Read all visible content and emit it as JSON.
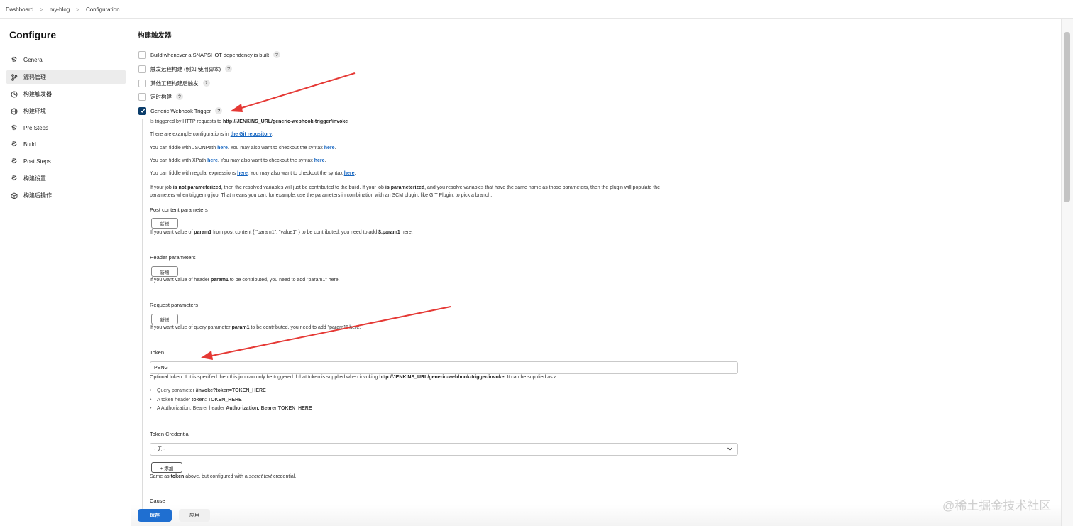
{
  "breadcrumb": {
    "items": [
      "Dashboard",
      "my-blog",
      "Configuration"
    ],
    "separator": ">"
  },
  "sidebar": {
    "title": "Configure",
    "items": [
      {
        "label": "General",
        "icon": "gear-icon"
      },
      {
        "label": "源码管理",
        "icon": "branch-icon"
      },
      {
        "label": "构建触发器",
        "icon": "clock-icon"
      },
      {
        "label": "构建环境",
        "icon": "globe-icon"
      },
      {
        "label": "Pre Steps",
        "icon": "gear-icon"
      },
      {
        "label": "Build",
        "icon": "gear-icon"
      },
      {
        "label": "Post Steps",
        "icon": "gear-icon"
      },
      {
        "label": "构建设置",
        "icon": "gear-icon"
      },
      {
        "label": "构建后操作",
        "icon": "cube-icon"
      }
    ]
  },
  "main": {
    "section_title": "构建触发器",
    "triggers": [
      {
        "label": "Build whenever a SNAPSHOT dependency is built",
        "checked": false
      },
      {
        "label": "触发远程构建 (例如,使用脚本)",
        "checked": false
      },
      {
        "label": "其他工程构建后触发",
        "checked": false
      },
      {
        "label": "定时构建",
        "checked": false
      },
      {
        "label": "Generic Webhook Trigger",
        "checked": true
      }
    ],
    "help_glyph": "?",
    "desc": {
      "line1_prefix": "Is triggered by HTTP requests to ",
      "line1_url": "http://JENKINS_URL/generic-webhook-trigger/invoke",
      "line2_prefix": "There are example configurations in ",
      "line2_link": "the Git repository",
      "line2_suffix": ".",
      "line3_a": "You can fiddle with JSONPath ",
      "line3_link1": "here",
      "line3_b": ". You may also want to checkout the syntax ",
      "line3_link2": "here",
      "line3_c": ".",
      "line4_a": "You can fiddle with XPath ",
      "line4_link1": "here",
      "line4_b": ". You may also want to checkout the syntax ",
      "line4_link2": "here",
      "line4_c": ".",
      "line5_a": "You can fiddle with regular expressions ",
      "line5_link1": "here",
      "line5_b": ". You may also want to checkout the syntax ",
      "line5_link2": "here",
      "line5_c": ".",
      "para_a": "If your job ",
      "para_b": "is not parameterized",
      "para_c": ", then the resolved variables will just be contributed to the build. If your job ",
      "para_d": "is parameterized",
      "para_e": ", and you resolve variables that have the same name as those parameters, then the plugin will populate the",
      "para_line2": "parameters when triggering job. That means you can, for example, use the parameters in combination with an SCM plugin, like GIT Plugin, to pick a branch."
    },
    "post_params": {
      "label": "Post content parameters",
      "button": "新增",
      "hint_a": "If you want value of ",
      "hint_b": "param1",
      "hint_c": " from post content { \"param1\": \"value1\" } to be contributed, you need to add ",
      "hint_d": "$.param1",
      "hint_e": " here."
    },
    "header_params": {
      "label": "Header parameters",
      "button": "新增",
      "hint_a": "If you want value of header ",
      "hint_b": "param1",
      "hint_c": " to be contributed, you need to add \"param1\" here."
    },
    "request_params": {
      "label": "Request parameters",
      "button": "新增",
      "hint_a": "If you want value of query parameter ",
      "hint_b": "param1",
      "hint_c": " to be contributed, you need to add \"param1\" here."
    },
    "token": {
      "label": "Token",
      "value": "PENG",
      "hint_a": "Optional token. If it is specified then this job can only be triggered if that token is supplied when invoking ",
      "hint_b": "http://JENKINS_URL/generic-webhook-trigger/invoke",
      "hint_c": ". It can be supplied as a:",
      "bullets": [
        {
          "a": "Query parameter ",
          "b": "/invoke?token=TOKEN_HERE"
        },
        {
          "a": "A token header ",
          "b": "token: TOKEN_HERE"
        },
        {
          "a": "A Authorization: Bearer header ",
          "b": "Authorization: Bearer TOKEN_HERE"
        }
      ]
    },
    "token_credential": {
      "label": "Token Credential",
      "selected": "- 无 -",
      "add_button": "+ 添加",
      "hint_a": "Same as ",
      "hint_b": "token",
      "hint_c": " above, but configured with a ",
      "hint_d": "secret text",
      "hint_e": " credential."
    },
    "cause_label": "Cause"
  },
  "footer": {
    "save": "保存",
    "apply": "应用"
  },
  "watermark": "@稀土掘金技术社区",
  "colors": {
    "accent": "#1f6fd1",
    "checkbox": "#0b3d6b",
    "link": "#1565c0",
    "arrow": "#e53935"
  }
}
